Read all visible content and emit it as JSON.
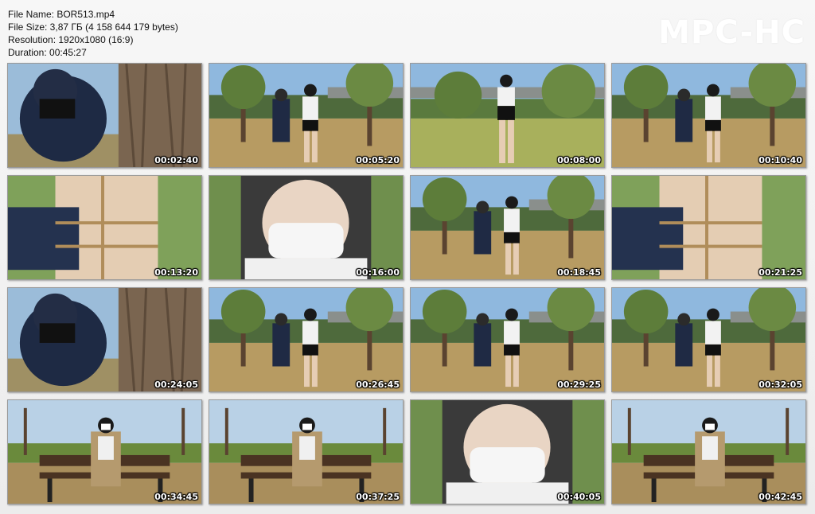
{
  "info": {
    "file_name": "File Name: BOR513.mp4",
    "file_size": "File Size: 3,87 ГБ (4 158 644 179 bytes)",
    "resolution": "Resolution: 1920x1080 (16:9)",
    "duration": "Duration: 00:45:27"
  },
  "logo": "MPC-HC",
  "thumbnails": [
    {
      "time": "00:02:40",
      "scene": "closeup-tree"
    },
    {
      "time": "00:05:20",
      "scene": "park-two"
    },
    {
      "time": "00:08:00",
      "scene": "park-one"
    },
    {
      "time": "00:10:40",
      "scene": "park-two"
    },
    {
      "time": "00:13:20",
      "scene": "closeup-body"
    },
    {
      "time": "00:16:00",
      "scene": "closeup-face"
    },
    {
      "time": "00:18:45",
      "scene": "park-two"
    },
    {
      "time": "00:21:25",
      "scene": "closeup-body"
    },
    {
      "time": "00:24:05",
      "scene": "closeup-tree"
    },
    {
      "time": "00:26:45",
      "scene": "park-two"
    },
    {
      "time": "00:29:25",
      "scene": "park-two"
    },
    {
      "time": "00:32:05",
      "scene": "park-two"
    },
    {
      "time": "00:34:45",
      "scene": "bench"
    },
    {
      "time": "00:37:25",
      "scene": "bench"
    },
    {
      "time": "00:40:05",
      "scene": "closeup-face"
    },
    {
      "time": "00:42:45",
      "scene": "bench"
    }
  ]
}
